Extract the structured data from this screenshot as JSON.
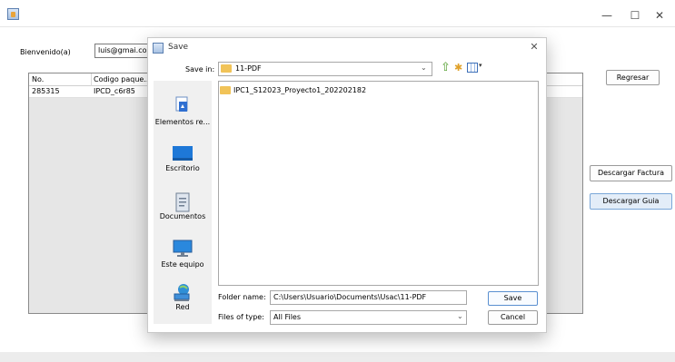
{
  "window": {
    "title": "",
    "minimize_glyph": "—",
    "maximize_glyph": "☐",
    "close_glyph": "✕"
  },
  "main": {
    "welcome_label": "Bienvenido(a)",
    "email_value": "luis@gmai.com",
    "table": {
      "headers": [
        "No.",
        "Codigo paque..."
      ],
      "rows": [
        [
          "285315",
          "IPCD_c6r85"
        ]
      ]
    },
    "buttons": {
      "regresar": "Regresar",
      "descargar_factura": "Descargar Factura",
      "descargar_guia": "Descargar Guia"
    }
  },
  "dialog": {
    "title": "Save",
    "close_glyph": "✕",
    "save_in_label": "Save in:",
    "save_in_value": "11-PDF",
    "dropdown_glyph": "⌄",
    "sidebar": [
      {
        "label": "Elementos re...",
        "icon": "recent-items-icon"
      },
      {
        "label": "Escritorio",
        "icon": "desktop-icon"
      },
      {
        "label": "Documentos",
        "icon": "documents-icon"
      },
      {
        "label": "Este equipo",
        "icon": "this-pc-icon"
      },
      {
        "label": "Red",
        "icon": "network-icon"
      }
    ],
    "files": [
      {
        "name": "IPC1_S12023_Proyecto1_202202182",
        "type": "folder"
      }
    ],
    "folder_name_label": "Folder name:",
    "folder_name_value": "C:\\Users\\Usuario\\Documents\\Usac\\11-PDF",
    "files_of_type_label": "Files of type:",
    "files_of_type_value": "All Files",
    "save_button": "Save",
    "cancel_button": "Cancel"
  },
  "colors": {
    "accent": "#5a8fd0",
    "folder": "#f1c358",
    "selected_button": "#e3edf8"
  }
}
